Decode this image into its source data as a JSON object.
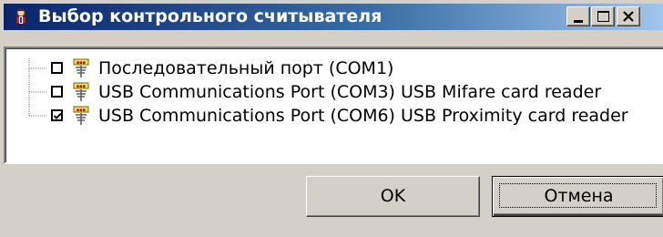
{
  "window": {
    "title": "Выбор контрольного считывателя",
    "title_icon": "reader-person-icon",
    "controls": {
      "minimize": "minimize-icon",
      "maximize": "maximize-icon",
      "close": "close-icon"
    }
  },
  "readers": [
    {
      "label": "Последовательный порт (COM1)",
      "checked": false,
      "icon": "card-reader-icon"
    },
    {
      "label": "USB Communications Port (COM3) USB Mifare card reader",
      "checked": false,
      "icon": "card-reader-icon"
    },
    {
      "label": "USB Communications Port (COM6) USB Proximity card reader",
      "checked": true,
      "icon": "card-reader-icon"
    }
  ],
  "buttons": {
    "ok_label": "OK",
    "cancel_label": "Отмена"
  },
  "colors": {
    "titlebar_start": "#0a246a",
    "titlebar_end": "#a6caf0",
    "face": "#d4d0c8"
  }
}
